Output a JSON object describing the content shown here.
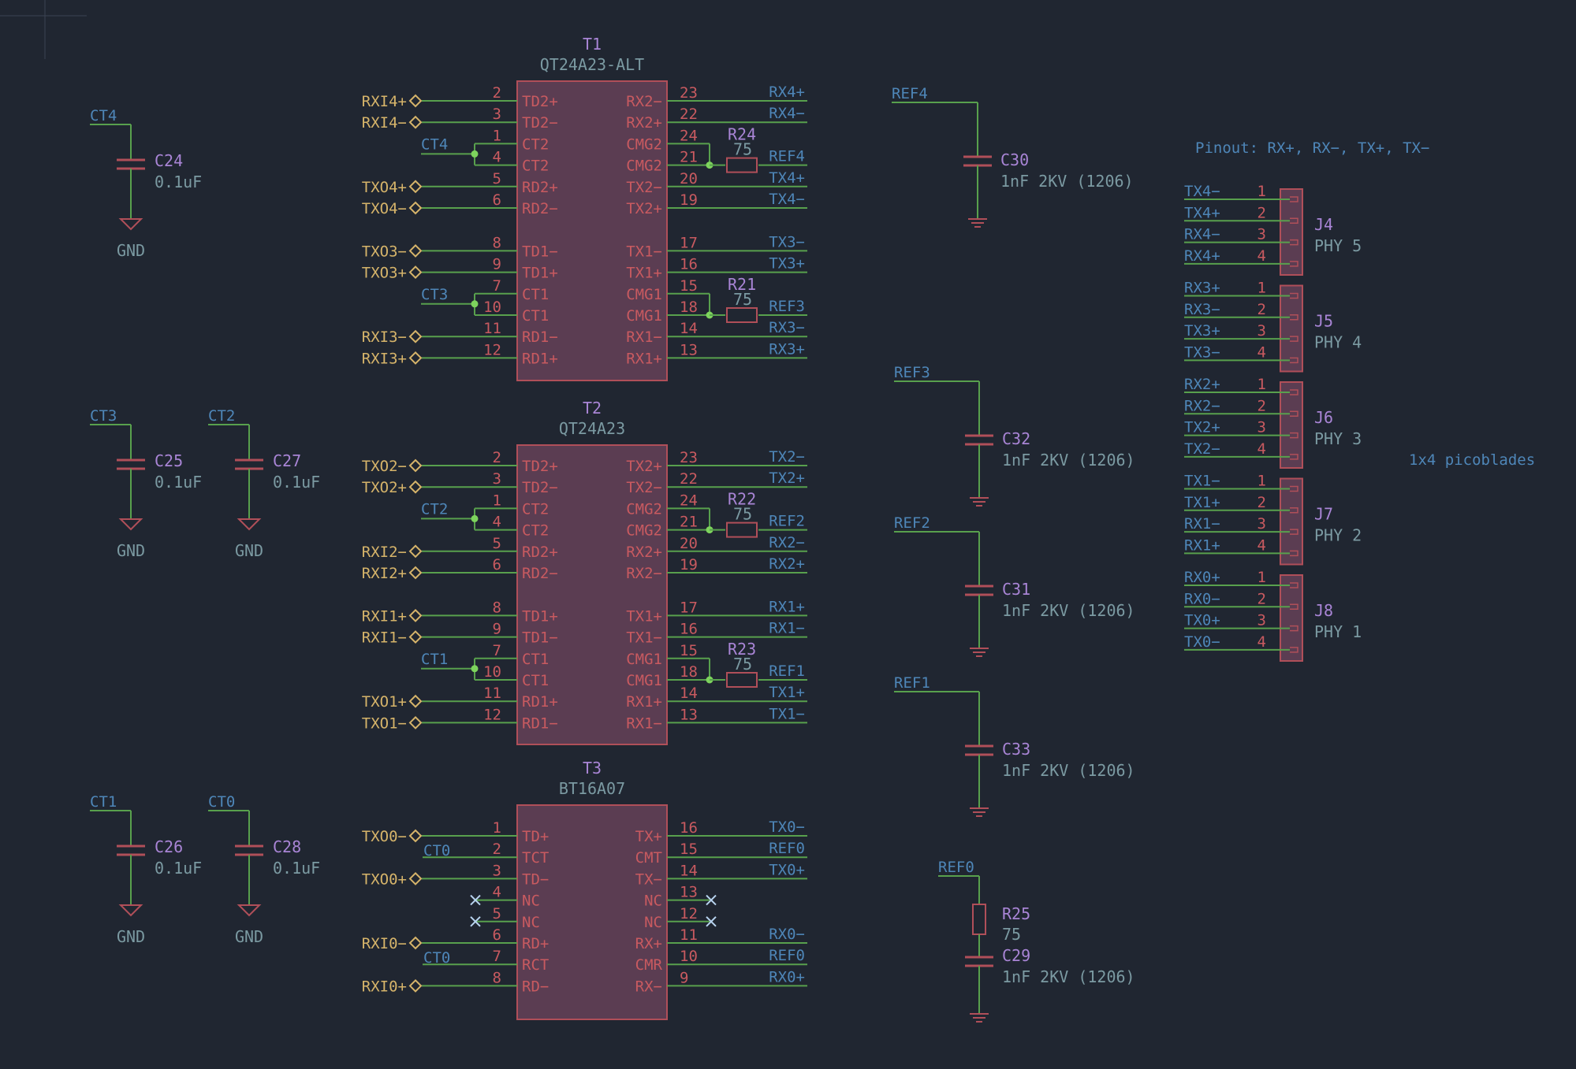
{
  "colors": {
    "background": "#202631",
    "wire": "#58a04d",
    "symbol_outline": "#b04f59",
    "symbol_fill": "#5b3d52",
    "net_label": "#4e86b8",
    "global_label": "#d6b46a",
    "reference": "#a985d6",
    "value": "#7b9aa2",
    "junction": "#7dd35d",
    "no_connect": "#b8d4f0"
  },
  "transformers": [
    {
      "ref": "T1",
      "value": "QT24A23-ALT",
      "left": [
        {
          "num": "2",
          "name": "TD2+",
          "label": "RXI4+",
          "type": "g"
        },
        {
          "num": "3",
          "name": "TD2−",
          "label": "RXI4−",
          "type": "g"
        },
        {
          "num": "1",
          "name": "CT2",
          "label": "CT4",
          "type": "ct"
        },
        {
          "num": "4",
          "name": "CT2",
          "label": "",
          "type": "ct2"
        },
        {
          "num": "5",
          "name": "RD2+",
          "label": "TXO4+",
          "type": "g"
        },
        {
          "num": "6",
          "name": "RD2−",
          "label": "TXO4−",
          "type": "g"
        },
        null,
        {
          "num": "8",
          "name": "TD1−",
          "label": "TXO3−",
          "type": "g"
        },
        {
          "num": "9",
          "name": "TD1+",
          "label": "TXO3+",
          "type": "g"
        },
        {
          "num": "7",
          "name": "CT1",
          "label": "CT3",
          "type": "ct"
        },
        {
          "num": "10",
          "name": "CT1",
          "label": "",
          "type": "ct2"
        },
        {
          "num": "11",
          "name": "RD1−",
          "label": "RXI3−",
          "type": "g"
        },
        {
          "num": "12",
          "name": "RD1+",
          "label": "RXI3+",
          "type": "g"
        }
      ],
      "right": [
        {
          "num": "23",
          "name": "RX2−",
          "label": "RX4+",
          "type": "n"
        },
        {
          "num": "22",
          "name": "RX2+",
          "label": "RX4−",
          "type": "n"
        },
        {
          "num": "24",
          "name": "CMG2",
          "label": "",
          "type": "cm"
        },
        {
          "num": "21",
          "name": "CMG2",
          "label": "REF4",
          "type": "cm2"
        },
        {
          "num": "20",
          "name": "TX2−",
          "label": "TX4+",
          "type": "n"
        },
        {
          "num": "19",
          "name": "TX2+",
          "label": "TX4−",
          "type": "n"
        },
        null,
        {
          "num": "17",
          "name": "TX1−",
          "label": "TX3−",
          "type": "n"
        },
        {
          "num": "16",
          "name": "TX1+",
          "label": "TX3+",
          "type": "n"
        },
        {
          "num": "15",
          "name": "CMG1",
          "label": "",
          "type": "cm"
        },
        {
          "num": "18",
          "name": "CMG1",
          "label": "REF3",
          "type": "cm2"
        },
        {
          "num": "14",
          "name": "RX1−",
          "label": "RX3−",
          "type": "n"
        },
        {
          "num": "13",
          "name": "RX1+",
          "label": "RX3+",
          "type": "n"
        }
      ],
      "resistors": [
        {
          "ref": "R24",
          "value": "75",
          "row": 3
        },
        {
          "ref": "R21",
          "value": "75",
          "row": 10
        }
      ]
    },
    {
      "ref": "T2",
      "value": "QT24A23",
      "left": [
        {
          "num": "2",
          "name": "TD2+",
          "label": "TXO2−",
          "type": "g"
        },
        {
          "num": "3",
          "name": "TD2−",
          "label": "TXO2+",
          "type": "g"
        },
        {
          "num": "1",
          "name": "CT2",
          "label": "CT2",
          "type": "ct"
        },
        {
          "num": "4",
          "name": "CT2",
          "label": "",
          "type": "ct2"
        },
        {
          "num": "5",
          "name": "RD2+",
          "label": "RXI2−",
          "type": "g"
        },
        {
          "num": "6",
          "name": "RD2−",
          "label": "RXI2+",
          "type": "g"
        },
        null,
        {
          "num": "8",
          "name": "TD1+",
          "label": "RXI1+",
          "type": "g"
        },
        {
          "num": "9",
          "name": "TD1−",
          "label": "RXI1−",
          "type": "g"
        },
        {
          "num": "7",
          "name": "CT1",
          "label": "CT1",
          "type": "ct"
        },
        {
          "num": "10",
          "name": "CT1",
          "label": "",
          "type": "ct2"
        },
        {
          "num": "11",
          "name": "RD1+",
          "label": "TXO1+",
          "type": "g"
        },
        {
          "num": "12",
          "name": "RD1−",
          "label": "TXO1−",
          "type": "g"
        }
      ],
      "right": [
        {
          "num": "23",
          "name": "TX2+",
          "label": "TX2−",
          "type": "n"
        },
        {
          "num": "22",
          "name": "TX2−",
          "label": "TX2+",
          "type": "n"
        },
        {
          "num": "24",
          "name": "CMG2",
          "label": "",
          "type": "cm"
        },
        {
          "num": "21",
          "name": "CMG2",
          "label": "REF2",
          "type": "cm2"
        },
        {
          "num": "20",
          "name": "RX2+",
          "label": "RX2−",
          "type": "n"
        },
        {
          "num": "19",
          "name": "RX2−",
          "label": "RX2+",
          "type": "n"
        },
        null,
        {
          "num": "17",
          "name": "TX1+",
          "label": "RX1+",
          "type": "n"
        },
        {
          "num": "16",
          "name": "TX1−",
          "label": "RX1−",
          "type": "n"
        },
        {
          "num": "15",
          "name": "CMG1",
          "label": "",
          "type": "cm"
        },
        {
          "num": "18",
          "name": "CMG1",
          "label": "REF1",
          "type": "cm2"
        },
        {
          "num": "14",
          "name": "RX1+",
          "label": "TX1+",
          "type": "n"
        },
        {
          "num": "13",
          "name": "RX1−",
          "label": "TX1−",
          "type": "n"
        }
      ],
      "resistors": [
        {
          "ref": "R22",
          "value": "75",
          "row": 3
        },
        {
          "ref": "R23",
          "value": "75",
          "row": 10
        }
      ]
    },
    {
      "ref": "T3",
      "value": "BT16A07",
      "left": [
        {
          "num": "1",
          "name": "TD+",
          "label": "TXO0−",
          "type": "g"
        },
        {
          "num": "2",
          "name": "TCT",
          "label": "CT0",
          "type": "n"
        },
        {
          "num": "3",
          "name": "TD−",
          "label": "TXO0+",
          "type": "g"
        },
        {
          "num": "4",
          "name": "NC",
          "label": "",
          "type": "x"
        },
        {
          "num": "5",
          "name": "NC",
          "label": "",
          "type": "x"
        },
        {
          "num": "6",
          "name": "RD+",
          "label": "RXI0−",
          "type": "g"
        },
        {
          "num": "7",
          "name": "RCT",
          "label": "CT0",
          "type": "n"
        },
        {
          "num": "8",
          "name": "RD−",
          "label": "RXI0+",
          "type": "g"
        }
      ],
      "right": [
        {
          "num": "16",
          "name": "TX+",
          "label": "TX0−",
          "type": "n"
        },
        {
          "num": "15",
          "name": "CMT",
          "label": "REF0",
          "type": "n"
        },
        {
          "num": "14",
          "name": "TX−",
          "label": "TX0+",
          "type": "n"
        },
        {
          "num": "13",
          "name": "NC",
          "label": "",
          "type": "x"
        },
        {
          "num": "12",
          "name": "NC",
          "label": "",
          "type": "x"
        },
        {
          "num": "11",
          "name": "RX+",
          "label": "RX0−",
          "type": "n"
        },
        {
          "num": "10",
          "name": "CMR",
          "label": "REF0",
          "type": "n"
        },
        {
          "num": "9",
          "name": "RX−",
          "label": "RX0+",
          "type": "n"
        }
      ],
      "resistors": []
    }
  ],
  "ct_capacitors": [
    {
      "ref": "C24",
      "value": "0.1uF",
      "net": "CT4",
      "power": "GND"
    },
    {
      "ref": "C25",
      "value": "0.1uF",
      "net": "CT3",
      "power": "GND"
    },
    {
      "ref": "C27",
      "value": "0.1uF",
      "net": "CT2",
      "power": "GND"
    },
    {
      "ref": "C26",
      "value": "0.1uF",
      "net": "CT1",
      "power": "GND"
    },
    {
      "ref": "C28",
      "value": "0.1uF",
      "net": "CT0",
      "power": "GND"
    }
  ],
  "ref_capacitors": [
    {
      "ref": "C30",
      "value": "1nF 2KV (1206)",
      "net": "REF4"
    },
    {
      "ref": "C32",
      "value": "1nF 2KV (1206)",
      "net": "REF3"
    },
    {
      "ref": "C31",
      "value": "1nF 2KV (1206)",
      "net": "REF2"
    },
    {
      "ref": "C33",
      "value": "1nF 2KV (1206)",
      "net": "REF1"
    }
  ],
  "ref0_network": {
    "net": "REF0",
    "resistor": {
      "ref": "R25",
      "value": "75"
    },
    "capacitor": {
      "ref": "C29",
      "value": "1nF 2KV (1206)"
    }
  },
  "connectors": [
    {
      "ref": "J4",
      "value": "PHY 5",
      "pins": [
        "TX4−",
        "TX4+",
        "RX4−",
        "RX4+"
      ]
    },
    {
      "ref": "J5",
      "value": "PHY 4",
      "pins": [
        "RX3+",
        "RX3−",
        "TX3+",
        "TX3−"
      ]
    },
    {
      "ref": "J6",
      "value": "PHY 3",
      "pins": [
        "RX2+",
        "RX2−",
        "TX2+",
        "TX2−"
      ]
    },
    {
      "ref": "J7",
      "value": "PHY 2",
      "pins": [
        "TX1−",
        "TX1+",
        "RX1−",
        "RX1+"
      ]
    },
    {
      "ref": "J8",
      "value": "PHY 1",
      "pins": [
        "RX0+",
        "RX0−",
        "TX0+",
        "TX0−"
      ]
    }
  ],
  "pin_numbers": [
    "1",
    "2",
    "3",
    "4"
  ],
  "notes": {
    "pinout": "Pinout: RX+, RX−, TX+, TX−",
    "connector_type": "1x4 picoblades"
  }
}
